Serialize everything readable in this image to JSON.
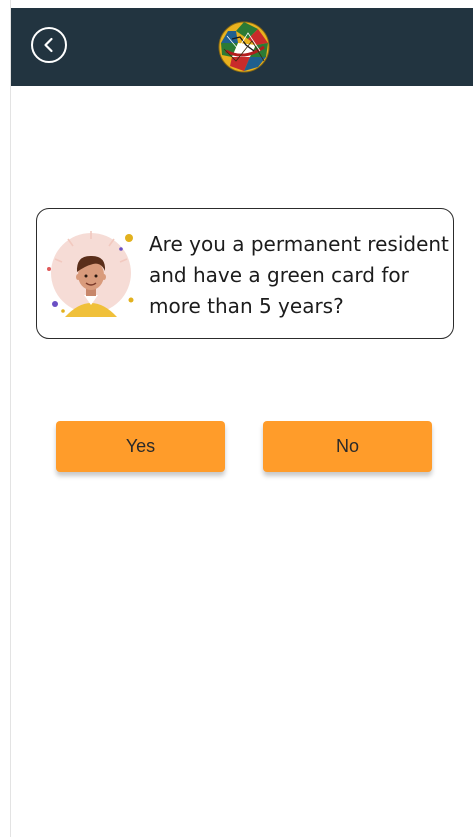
{
  "header": {
    "back_icon": "back-arrow-icon",
    "logo_icon": "globe-logo-icon",
    "background_color": "#223440"
  },
  "question": {
    "avatar_icon": "person-avatar-icon",
    "text": "Are you a permanent resident and have a green card for more than 5 years?"
  },
  "answers": {
    "yes_label": "Yes",
    "no_label": "No",
    "button_color": "#ff9c2a"
  }
}
